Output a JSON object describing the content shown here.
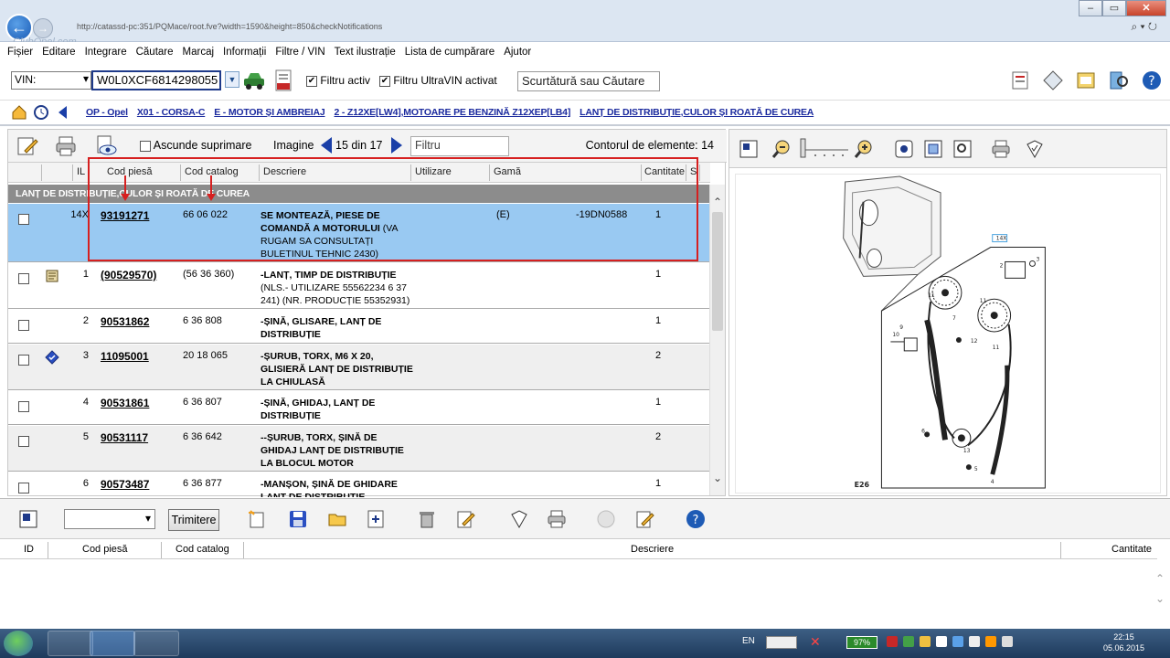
{
  "browser": {
    "url": "http://catassd-pc:351/PQMace/root.fve?width=1590&height=850&checkNotifications",
    "watermark": "ClubOpel.com",
    "search_glyph": "⌕ ▾ ↻"
  },
  "menu": [
    "Fișier",
    "Editare",
    "Integrare",
    "Căutare",
    "Marcaj",
    "Informații",
    "Filtre / VIN",
    "Text ilustrație",
    "Lista de cumpărare",
    "Ajutor"
  ],
  "vin": {
    "type_label": "VIN:",
    "value": "W0L0XCF6814298055",
    "filter_active": "Filtru activ",
    "filter_ultra": "Filtru UltraVIN activat",
    "shortcut_placeholder": "Scurtătură sau Căutare"
  },
  "breadcrumb": [
    "OP - Opel",
    "X01 - CORSA-C",
    "E - MOTOR ȘI AMBREIAJ",
    "2 - Z12XE[LW4],MOTOARE PE BENZINĂ Z12XEP[LB4]",
    "LANȚ DE DISTRIBUȚIE,CULOR ȘI ROATĂ DE CUREA"
  ],
  "parts_toolbar": {
    "hide_deleted": "Ascunde suprimare",
    "image_label": "Imagine",
    "page_info": "15 din 17",
    "filter_placeholder": "Filtru",
    "count_label": "Contorul de elemente: 14"
  },
  "columns": {
    "il": "IL",
    "code": "Cod piesă",
    "catalog": "Cod catalog",
    "desc": "Descriere",
    "usage": "Utilizare",
    "gama": "Gamă",
    "qty": "Cantitate",
    "s": "S"
  },
  "group_title": "LANȚ DE DISTRIBUȚIE,CULOR ȘI ROATĂ DE CUREA",
  "rows": [
    {
      "il": "14X",
      "code": "93191271",
      "catalog": "66 06 022",
      "desc_bold": "SE MONTEAZĂ, PIESE DE COMANDĂ A MOTORULUI",
      "desc_rest": " (VA RUGAM SA CONSULTAȚI BULETINUL TEHNIC 2430)",
      "gama": "(E)",
      "gama2": "-19DN0588",
      "qty": "1"
    },
    {
      "il": "1",
      "code": "(90529570)",
      "catalog": "(56 36 360)",
      "desc_bold": "-LANȚ, TIMP DE DISTRIBUȚIE",
      "desc_rest": " (NLS.- UTILIZARE 55562234 6 37 241) (NR. PRODUCȚIE 55352931)",
      "gama": "",
      "gama2": "",
      "qty": "1"
    },
    {
      "il": "2",
      "code": "90531862",
      "catalog": "6 36 808",
      "desc_bold": "-ȘINĂ, GLISARE, LANȚ DE DISTRIBUȚIE",
      "desc_rest": "",
      "gama": "",
      "gama2": "",
      "qty": "1"
    },
    {
      "il": "3",
      "code": "11095001",
      "catalog": "20 18 065",
      "desc_bold": "-ȘURUB, TORX, M6 X 20, GLISIERĂ LANȚ DE DISTRIBUȚIE LA CHIULASĂ",
      "desc_rest": "",
      "gama": "",
      "gama2": "",
      "qty": "2"
    },
    {
      "il": "4",
      "code": "90531861",
      "catalog": "6 36 807",
      "desc_bold": "-ȘINĂ, GHIDAJ, LANȚ DE DISTRIBUȚIE",
      "desc_rest": "",
      "gama": "",
      "gama2": "",
      "qty": "1"
    },
    {
      "il": "5",
      "code": "90531117",
      "catalog": "6 36 642",
      "desc_bold": "--ȘURUB, TORX, ȘINĂ DE GHIDAJ LANȚ DE DISTRIBUȚIE LA BLOCUL MOTOR",
      "desc_rest": "",
      "gama": "",
      "gama2": "",
      "qty": "2"
    },
    {
      "il": "6",
      "code": "90573487",
      "catalog": "6 36 877",
      "desc_bold": "-MANȘON, ȘINĂ DE GHIDARE LANȚ DE DISTRIBUȚIE",
      "desc_rest": "",
      "gama": "",
      "gama2": "",
      "qty": "1"
    }
  ],
  "illustration": {
    "label": "E26"
  },
  "basket": {
    "send": "Trimitere",
    "columns": {
      "id": "ID",
      "code": "Cod piesă",
      "catalog": "Cod catalog",
      "desc": "Descriere",
      "qty": "Cantitate"
    }
  },
  "taskbar": {
    "lang": "EN",
    "battery": "97%",
    "time": "22:15",
    "date": "05.06.2015"
  }
}
